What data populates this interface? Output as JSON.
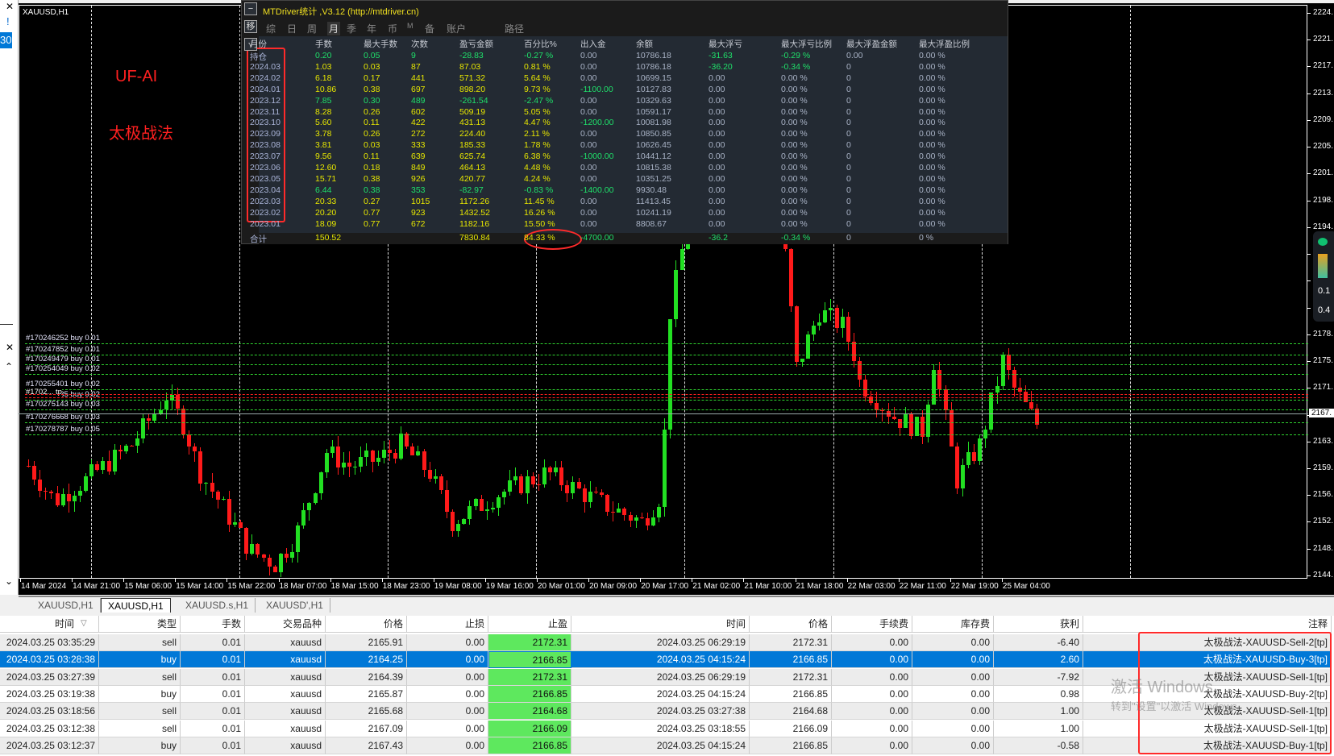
{
  "left_panel": {
    "close1": "✕",
    "warn": "!",
    "selected_value": "30",
    "close2": "✕",
    "up": "⌃",
    "down": "⌄"
  },
  "chart": {
    "symbol_label": "XAUUSD,H1",
    "overlay_title": "UF-AI",
    "overlay_subtitle": "太极战法",
    "price_labels": [
      "2224.",
      "2221.",
      "2217.",
      "2213.",
      "2209.",
      "2205.",
      "2201.",
      "2198.",
      "2194.",
      "2190.",
      "2186.",
      "2182.",
      "2178.",
      "2175.",
      "2171.",
      "2167.",
      "2163.",
      "2159.",
      "2156.",
      "2152.",
      "2148.",
      "2144."
    ],
    "price_top": 2224.6,
    "price_step": 3.82,
    "current_price": 2167.5,
    "current_price_label": "2167.",
    "time_labels": [
      "14 Mar 2024",
      "14 Mar 21:00",
      "15 Mar 06:00",
      "15 Mar 14:00",
      "15 Mar 22:00",
      "18 Mar 07:00",
      "18 Mar 15:00",
      "18 Mar 23:00",
      "19 Mar 08:00",
      "19 Mar 16:00",
      "20 Mar 01:00",
      "20 Mar 09:00",
      "20 Mar 17:00",
      "21 Mar 02:00",
      "21 Mar 10:00",
      "21 Mar 18:00",
      "22 Mar 03:00",
      "22 Mar 11:00",
      "22 Mar 19:00",
      "25 Mar 04:00"
    ],
    "candle_count": 177,
    "close_waypoints": [
      [
        0,
        2160
      ],
      [
        4.5,
        2155
      ],
      [
        10,
        2158
      ],
      [
        18,
        2163
      ],
      [
        24,
        2170
      ],
      [
        27,
        2166
      ],
      [
        30,
        2159
      ],
      [
        35.6,
        2152
      ],
      [
        38.6,
        2148
      ],
      [
        43,
        2146
      ],
      [
        46.7,
        2150
      ],
      [
        52,
        2162
      ],
      [
        56,
        2160
      ],
      [
        61,
        2161
      ],
      [
        65,
        2163
      ],
      [
        70,
        2159
      ],
      [
        74,
        2152
      ],
      [
        82,
        2156
      ],
      [
        90.5,
        2159
      ],
      [
        99,
        2155
      ],
      [
        107,
        2152
      ],
      [
        110.5,
        2156
      ],
      [
        112,
        2182
      ],
      [
        115,
        2195
      ],
      [
        119,
        2210
      ],
      [
        126,
        2205
      ],
      [
        132,
        2190
      ],
      [
        134,
        2174
      ],
      [
        138,
        2182
      ],
      [
        142,
        2180
      ],
      [
        144,
        2176
      ],
      [
        145,
        2172
      ],
      [
        151,
        2167
      ],
      [
        156,
        2165
      ],
      [
        158,
        2175
      ],
      [
        162,
        2158
      ],
      [
        166,
        2163
      ],
      [
        170,
        2175
      ],
      [
        172,
        2171
      ],
      [
        176,
        2166
      ]
    ],
    "up_color": "#22e022",
    "down_color": "#ff1a1a",
    "orders": [
      {
        "label": "#170246252 buy 0.01",
        "price": 2177.45
      },
      {
        "label": "#170247852 buy 0.01",
        "price": 2175.9
      },
      {
        "label": "#170249479 buy 0.01",
        "price": 2174.5
      },
      {
        "label": "#170254049 buy 0.02",
        "price": 2173.1
      },
      {
        "label": "#170255401 buy 0.02",
        "price": 2170.9
      },
      {
        "label": "#170263935 buy 0.02",
        "price": 2169.4
      },
      {
        "label": "#170275143 buy 0.03",
        "price": 2168.0
      },
      {
        "label": "#170276668 buy 0.03",
        "price": 2166.2
      },
      {
        "label": "#170278787 buy 0.05",
        "price": 2164.5
      }
    ],
    "tp_overlap_label": "#1702... tp",
    "red_lines": [
      2170.2,
      2169.8
    ],
    "widget": {
      "v1": "0.1",
      "v2": "0.4"
    }
  },
  "stats": {
    "title": "MTDriver统计 ,V3.12 (http://mtdriver.cn)",
    "side_icons": [
      "−",
      "移",
      "√"
    ],
    "tabs": [
      "综",
      "日",
      "周",
      "月",
      "季",
      "年",
      "币",
      "M",
      "备",
      "账户",
      "路径"
    ],
    "active_tab": 3,
    "headers": [
      "月份",
      "手数",
      "最大手数",
      "次数",
      "盈亏金额",
      "百分比%",
      "出入金",
      "余额",
      "最大浮亏",
      "最大浮亏比例",
      "最大浮盈金额",
      "最大浮盈比例"
    ],
    "yellow": "#e6e600",
    "green": "#1fe06a",
    "grey": "#a9b3c6",
    "rows": [
      {
        "tone": "green",
        "cells": [
          "持仓",
          "0.20",
          "0.05",
          "9",
          "-28.83",
          "-0.27 %",
          "0.00",
          "10786.18",
          "-31.63",
          "-0.29 %",
          "0.00",
          "0.00 %"
        ]
      },
      {
        "tone": "yellow",
        "cells": [
          "2024.03",
          "1.03",
          "0.03",
          "87",
          "87.03",
          "0.81 %",
          "0.00",
          "10786.18",
          "-36.20",
          "-0.34 %",
          "0",
          "0.00 %"
        ]
      },
      {
        "tone": "yellow",
        "cells": [
          "2024.02",
          "6.18",
          "0.17",
          "441",
          "571.32",
          "5.64 %",
          "0.00",
          "10699.15",
          "0.00",
          "0.00 %",
          "0",
          "0.00 %"
        ]
      },
      {
        "tone": "yellow",
        "cells": [
          "2024.01",
          "10.86",
          "0.38",
          "697",
          "898.20",
          "9.73 %",
          "-1100.00",
          "10127.83",
          "0.00",
          "0.00 %",
          "0",
          "0.00 %"
        ]
      },
      {
        "tone": "green",
        "cells": [
          "2023.12",
          "7.85",
          "0.30",
          "489",
          "-261.54",
          "-2.47 %",
          "0.00",
          "10329.63",
          "0.00",
          "0.00 %",
          "0",
          "0.00 %"
        ]
      },
      {
        "tone": "yellow",
        "cells": [
          "2023.11",
          "8.28",
          "0.26",
          "602",
          "509.19",
          "5.05 %",
          "0.00",
          "10591.17",
          "0.00",
          "0.00 %",
          "0",
          "0.00 %"
        ]
      },
      {
        "tone": "yellow",
        "cells": [
          "2023.10",
          "5.60",
          "0.11",
          "422",
          "431.13",
          "4.47 %",
          "-1200.00",
          "10081.98",
          "0.00",
          "0.00 %",
          "0",
          "0.00 %"
        ]
      },
      {
        "tone": "yellow",
        "cells": [
          "2023.09",
          "3.78",
          "0.26",
          "272",
          "224.40",
          "2.11 %",
          "0.00",
          "10850.85",
          "0.00",
          "0.00 %",
          "0",
          "0.00 %"
        ]
      },
      {
        "tone": "yellow",
        "cells": [
          "2023.08",
          "3.81",
          "0.03",
          "333",
          "185.33",
          "1.78 %",
          "0.00",
          "10626.45",
          "0.00",
          "0.00 %",
          "0",
          "0.00 %"
        ]
      },
      {
        "tone": "yellow",
        "cells": [
          "2023.07",
          "9.56",
          "0.11",
          "639",
          "625.74",
          "6.38 %",
          "-1000.00",
          "10441.12",
          "0.00",
          "0.00 %",
          "0",
          "0.00 %"
        ]
      },
      {
        "tone": "yellow",
        "cells": [
          "2023.06",
          "12.60",
          "0.18",
          "849",
          "464.13",
          "4.48 %",
          "0.00",
          "10815.38",
          "0.00",
          "0.00 %",
          "0",
          "0.00 %"
        ]
      },
      {
        "tone": "yellow",
        "cells": [
          "2023.05",
          "15.71",
          "0.38",
          "926",
          "420.77",
          "4.24 %",
          "0.00",
          "10351.25",
          "0.00",
          "0.00 %",
          "0",
          "0.00 %"
        ]
      },
      {
        "tone": "green",
        "cells": [
          "2023.04",
          "6.44",
          "0.38",
          "353",
          "-82.97",
          "-0.83 %",
          "-1400.00",
          "9930.48",
          "0.00",
          "0.00 %",
          "0",
          "0.00 %"
        ]
      },
      {
        "tone": "yellow",
        "cells": [
          "2023.03",
          "20.33",
          "0.27",
          "1015",
          "1172.26",
          "11.45 %",
          "0.00",
          "11413.45",
          "0.00",
          "0.00 %",
          "0",
          "0.00 %"
        ]
      },
      {
        "tone": "yellow",
        "cells": [
          "2023.02",
          "20.20",
          "0.77",
          "923",
          "1432.52",
          "16.26 %",
          "0.00",
          "10241.19",
          "0.00",
          "0.00 %",
          "0",
          "0.00 %"
        ]
      },
      {
        "tone": "yellow",
        "cells": [
          "2023.01",
          "18.09",
          "0.77",
          "672",
          "1182.16",
          "15.50 %",
          "0.00",
          "8808.67",
          "0.00",
          "0.00 %",
          "0",
          "0.00 %"
        ]
      }
    ],
    "total": [
      "合计",
      "150.52",
      "",
      "",
      "7830.84",
      "84.33 %",
      "-4700.00",
      "",
      "-36.2",
      "-0.34 %",
      "0",
      "0 %"
    ]
  },
  "chart_tabs": [
    "XAUUSD,H1",
    "XAUUSD,H1",
    "XAUUSD.s,H1",
    "XAUUSD',H1"
  ],
  "active_chart_tab": 1,
  "trades": {
    "headers": [
      "时间",
      "类型",
      "手数",
      "交易品种",
      "价格",
      "止损",
      "止盈",
      "时间",
      "价格",
      "手续费",
      "库存费",
      "获利",
      "注释"
    ],
    "sort_icon": "▽",
    "selected_row": 1,
    "tp_color": "#5ee85e",
    "rows": [
      [
        "2024.03.25 03:35:29",
        "sell",
        "0.01",
        "xauusd",
        "2165.91",
        "0.00",
        "2172.31",
        "2024.03.25 06:29:19",
        "2172.31",
        "0.00",
        "0.00",
        "-6.40",
        "太极战法-XAUUSD-Sell-2[tp]"
      ],
      [
        "2024.03.25 03:28:38",
        "buy",
        "0.01",
        "xauusd",
        "2164.25",
        "0.00",
        "2166.85",
        "2024.03.25 04:15:24",
        "2166.85",
        "0.00",
        "0.00",
        "2.60",
        "太极战法-XAUUSD-Buy-3[tp]"
      ],
      [
        "2024.03.25 03:27:39",
        "sell",
        "0.01",
        "xauusd",
        "2164.39",
        "0.00",
        "2172.31",
        "2024.03.25 06:29:19",
        "2172.31",
        "0.00",
        "0.00",
        "-7.92",
        "太极战法-XAUUSD-Sell-1[tp]"
      ],
      [
        "2024.03.25 03:19:38",
        "buy",
        "0.01",
        "xauusd",
        "2165.87",
        "0.00",
        "2166.85",
        "2024.03.25 04:15:24",
        "2166.85",
        "0.00",
        "0.00",
        "0.98",
        "太极战法-XAUUSD-Buy-2[tp]"
      ],
      [
        "2024.03.25 03:18:56",
        "sell",
        "0.01",
        "xauusd",
        "2165.68",
        "0.00",
        "2164.68",
        "2024.03.25 03:27:38",
        "2164.68",
        "0.00",
        "0.00",
        "1.00",
        "太极战法-XAUUSD-Sell-1[tp]"
      ],
      [
        "2024.03.25 03:12:38",
        "sell",
        "0.01",
        "xauusd",
        "2167.09",
        "0.00",
        "2166.09",
        "2024.03.25 03:18:55",
        "2166.09",
        "0.00",
        "0.00",
        "1.00",
        "太极战法-XAUUSD-Sell-1[tp]"
      ],
      [
        "2024.03.25 03:12:37",
        "buy",
        "0.01",
        "xauusd",
        "2167.43",
        "0.00",
        "2166.85",
        "2024.03.25 04:15:24",
        "2166.85",
        "0.00",
        "0.00",
        "-0.58",
        "太极战法-XAUUSD-Buy-1[tp]"
      ]
    ]
  },
  "watermark": {
    "line1": "激活 Windows",
    "line2": "转到\"设置\"以激活 Windows。"
  }
}
